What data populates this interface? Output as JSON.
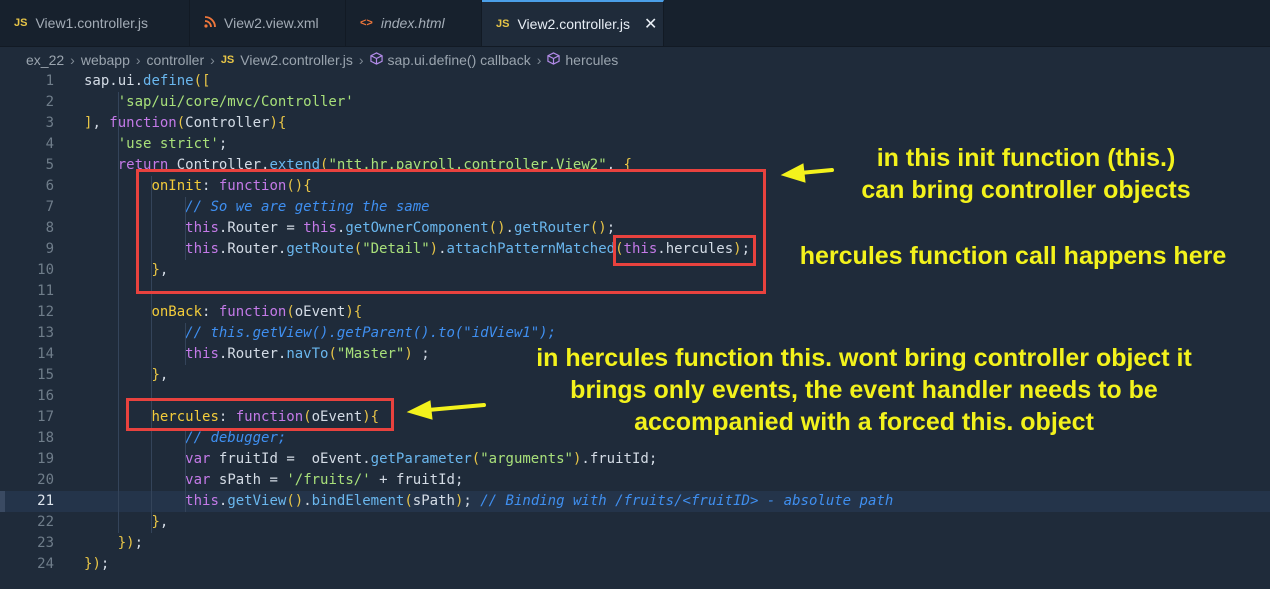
{
  "tabs": [
    {
      "icon": "JS",
      "label": "View1.controller.js",
      "active": false
    },
    {
      "icon": "rss",
      "label": "View2.view.xml",
      "active": false
    },
    {
      "icon": "<>",
      "label": "index.html",
      "active": false
    },
    {
      "icon": "JS",
      "label": "View2.controller.js",
      "active": true
    }
  ],
  "tab_close_symbol": "✕",
  "breadcrumb": [
    "ex_22",
    "webapp",
    "controller",
    "View2.controller.js",
    "sap.ui.define() callback",
    "hercules"
  ],
  "breadcrumb_js_icon": "JS",
  "line_numbers": [
    "1",
    "2",
    "3",
    "4",
    "5",
    "6",
    "7",
    "8",
    "9",
    "10",
    "11",
    "12",
    "13",
    "14",
    "15",
    "16",
    "17",
    "18",
    "19",
    "20",
    "21",
    "22",
    "23",
    "24"
  ],
  "active_line": 21,
  "code_lines": [
    "sap.ui.define([",
    "    'sap/ui/core/mvc/Controller'",
    "], function(Controller){",
    "    'use strict';",
    "    return Controller.extend(\"ntt.hr.payroll.controller.View2\", {",
    "        onInit: function(){",
    "            // So we are getting the same",
    "            this.Router = this.getOwnerComponent().getRouter();",
    "            this.Router.getRoute(\"Detail\").attachPatternMatched(this.hercules);",
    "        },",
    "",
    "        onBack: function(oEvent){",
    "            // this.getView().getParent().to(\"idView1\");",
    "            this.Router.navTo(\"Master\") ;",
    "        },",
    "",
    "        hercules: function(oEvent){",
    "            // debugger;",
    "            var fruitId =  oEvent.getParameter(\"arguments\").fruitId;",
    "            var sPath = '/fruits/' + fruitId;",
    "            this.getView().bindElement(sPath); // Binding with /fruits/<fruitID> - absolute path",
    "        },",
    "    });",
    "});"
  ],
  "annotations": {
    "init_note": [
      "in this init function (this.)",
      "can bring controller objects"
    ],
    "call_note": "hercules function call happens here",
    "hercules_note": [
      "in hercules function this. wont bring controller object it",
      "brings only events, the event handler needs to be",
      "accompanied with a forced this. object"
    ]
  },
  "colors": {
    "background": "#1f2b3a",
    "annotation_text": "#f3f21c",
    "annotation_box": "#e8423e",
    "active_tab_border": "#4b9fe8"
  }
}
